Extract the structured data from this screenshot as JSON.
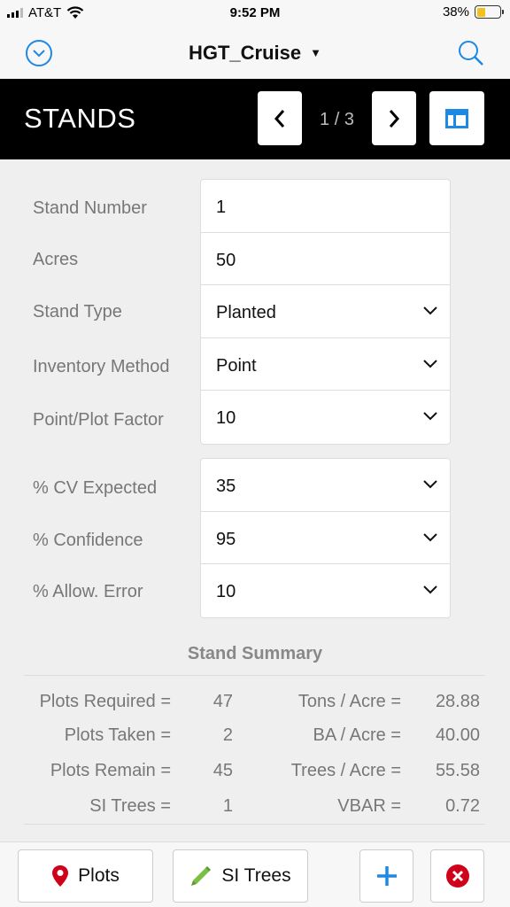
{
  "status": {
    "carrier": "AT&T",
    "time": "9:52 PM",
    "battery": "38%",
    "battery_level": 0.38
  },
  "nav": {
    "title": "HGT_Cruise",
    "left_icon": "circle-chevron-down-icon",
    "right_icon": "search-icon"
  },
  "header": {
    "title": "STANDS",
    "pager": "1 / 3"
  },
  "fields_group1": [
    {
      "label": "Stand Number",
      "value": "1",
      "dropdown": false
    },
    {
      "label": "Acres",
      "value": "50",
      "dropdown": false
    },
    {
      "label": "Stand Type",
      "value": "Planted",
      "dropdown": true
    },
    {
      "label": "Inventory Method",
      "value": "Point",
      "dropdown": true
    },
    {
      "label": "Point/Plot Factor",
      "value": "10",
      "dropdown": true
    }
  ],
  "fields_group2": [
    {
      "label": "% CV Expected",
      "value": "35",
      "dropdown": true
    },
    {
      "label": "% Confidence",
      "value": "95",
      "dropdown": true
    },
    {
      "label": "% Allow. Error",
      "value": "10",
      "dropdown": true
    }
  ],
  "summary": {
    "title": "Stand Summary",
    "left": [
      {
        "label": "Plots Required =",
        "value": "47"
      },
      {
        "label": "Plots Taken =",
        "value": "2"
      },
      {
        "label": "Plots Remain =",
        "value": "45"
      },
      {
        "label": "SI Trees =",
        "value": "1"
      }
    ],
    "right": [
      {
        "label": "Tons / Acre =",
        "value": "28.88"
      },
      {
        "label": "BA / Acre =",
        "value": "40.00"
      },
      {
        "label": "Trees / Acre =",
        "value": "55.58"
      },
      {
        "label": "VBAR =",
        "value": "0.72"
      }
    ]
  },
  "toolbar": {
    "plots_label": "Plots",
    "si_trees_label": "SI Trees"
  },
  "colors": {
    "accent": "#1e88e5",
    "header_bg": "#000000",
    "danger": "#d0021b",
    "pin": "#d0021b",
    "pencil": "#7bc043",
    "battery": "#f2c21b"
  }
}
